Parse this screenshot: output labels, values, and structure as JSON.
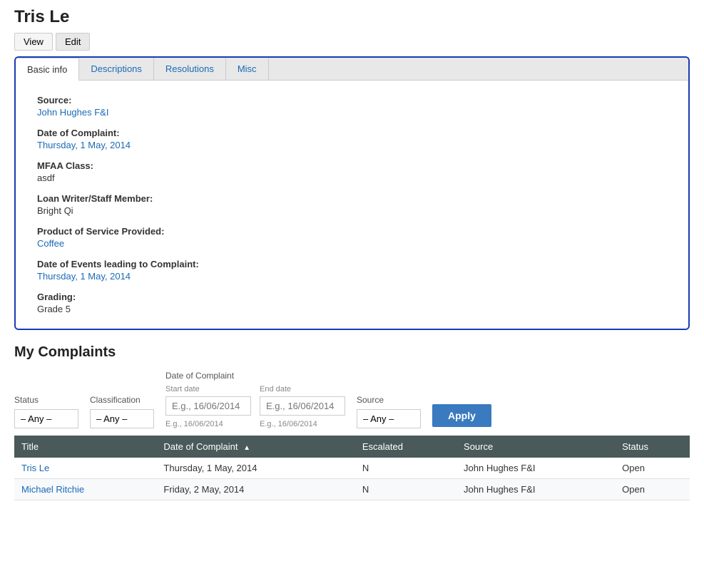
{
  "page": {
    "title": "Tris Le"
  },
  "action_buttons": {
    "view_label": "View",
    "edit_label": "Edit"
  },
  "tabs": [
    {
      "label": "Basic info",
      "active": true
    },
    {
      "label": "Descriptions",
      "active": false
    },
    {
      "label": "Resolutions",
      "active": false
    },
    {
      "label": "Misc",
      "active": false
    }
  ],
  "basic_info": {
    "source_label": "Source:",
    "source_value": "John Hughes F&I",
    "date_of_complaint_label": "Date of Complaint:",
    "date_of_complaint_value": "Thursday, 1 May, 2014",
    "mfaa_class_label": "MFAA Class:",
    "mfaa_class_value": "asdf",
    "loan_writer_label": "Loan Writer/Staff Member:",
    "loan_writer_value": "Bright Qi",
    "product_label": "Product of Service Provided:",
    "product_value": "Coffee",
    "date_of_events_label": "Date of Events leading to Complaint:",
    "date_of_events_value": "Thursday, 1 May, 2014",
    "grading_label": "Grading:",
    "grading_value": "Grade 5"
  },
  "my_complaints": {
    "section_title": "My Complaints",
    "filters": {
      "status_label": "Status",
      "status_default": "– Any –",
      "classification_label": "Classification",
      "classification_default": "– Any –",
      "date_of_complaint_label": "Date of Complaint",
      "start_date_label": "Start date",
      "start_date_placeholder": "E.g., 16/06/2014",
      "end_date_label": "End date",
      "end_date_placeholder": "E.g., 16/06/2014",
      "source_label": "Source",
      "source_default": "– Any –",
      "apply_label": "Apply"
    },
    "table": {
      "columns": [
        {
          "label": "Title",
          "sortable": false
        },
        {
          "label": "Date of Complaint",
          "sortable": true
        },
        {
          "label": "Escalated",
          "sortable": false
        },
        {
          "label": "Source",
          "sortable": false
        },
        {
          "label": "Status",
          "sortable": false
        }
      ],
      "rows": [
        {
          "title": "Tris Le",
          "title_link": true,
          "date_of_complaint": "Thursday, 1 May, 2014",
          "escalated": "N",
          "source": "John Hughes F&I",
          "status": "Open"
        },
        {
          "title": "Michael Ritchie",
          "title_link": true,
          "date_of_complaint": "Friday, 2 May, 2014",
          "escalated": "N",
          "source": "John Hughes F&I",
          "status": "Open"
        }
      ]
    }
  }
}
